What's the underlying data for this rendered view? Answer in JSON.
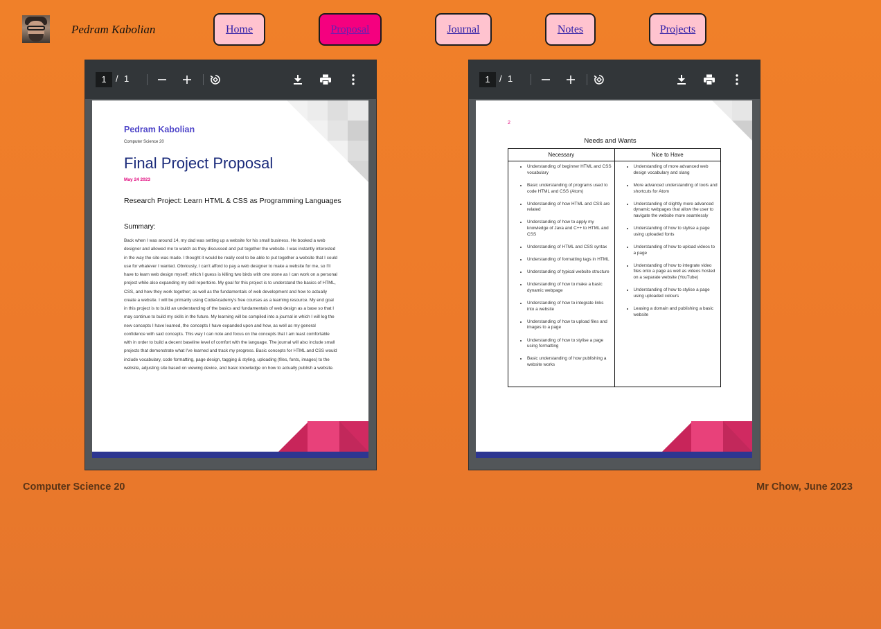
{
  "header": {
    "site_name": "Pedram Kabolian",
    "nav": [
      {
        "label": "Home "
      },
      {
        "label": "Proposal"
      },
      {
        "label": "Journal "
      },
      {
        "label": "Notes "
      },
      {
        "label": "Projects"
      }
    ],
    "active_nav": "Proposal"
  },
  "viewers": [
    {
      "page_current": "1",
      "page_sep": "/",
      "page_total": "1",
      "document": {
        "name": "Pedram Kabolian",
        "course": "Computer Science 20",
        "title": "Final Project Proposal",
        "date": "May 24 2023",
        "research": "Research Project: Learn HTML & CSS as Programming Languages",
        "summary_heading": "Summary:",
        "summary_body": "Back when I was around 14, my dad was setting up a website for his small business. He booked a web designer and allowed me to watch as they discussed and put together the website. I was instantly interested in the way the site was made. I thought it would be really cool to be able to put together a website that I could use for whatever I wanted. Obviously, I can't afford to pay a web designer to make a website for me, so I'll have to learn web design myself; which I guess is killing two birds with one stone as I can work on a personal project while also expanding my skill repertoire. My goal for this project is to understand the basics of HTML, CSS, and how they work together; as well as the fundamentals of web development and how to actually create a website. I will be primarily using CodeAcademy's free courses as a learning resource. My end goal in this project is to build an understanding of the basics and fundamentals of web design as a base so that I may continue to build my skills in the future. My learning will be compiled into a journal in which I will log the new concepts I have learned, the concepts I have expanded upon and how, as well as my general confidence with said concepts. This way I can note and focus on the concepts that I am least comfortable with in order to build a decent baseline level of comfort with the language. The journal will also include small projects that demonstrate what I've learned and track my progress. Basic concepts for HTML and CSS would include vocabulary, code formatting, page design, tagging & styling, uploading (files, fonts, images) to the website, adjusting site based on viewing device, and basic knowledge on how to actually publish a website."
      }
    },
    {
      "page_current": "1",
      "page_sep": "/",
      "page_total": "1",
      "document": {
        "page_number": "2",
        "title": "Needs and Wants",
        "col_necessary": "Necessary",
        "col_nice": "Nice to Have",
        "necessary": [
          "Understanding of beginner HTML and CSS vocabulary",
          "Basic understanding of programs used to code HTML and CSS (Atom)",
          "Understanding of how HTML and CSS are related",
          "Understanding of how to apply my knowledge of Java and C++ to HTML and CSS",
          "Understanding of HTML and CSS syntax",
          "Understanding of formatting tags in HTML",
          "Understanding of typical website structure",
          "Understanding of how to make a basic dynamic webpage",
          "Understanding of how to integrate links into a website",
          "Understanding of how to upload files and images to a page",
          "Understanding of how to stylise a page using formatting",
          "Basic understanding of how publishing a website works"
        ],
        "nice_to_have": [
          "Understanding of more advanced web design vocabulary and slang",
          "More advanced understanding of tools and shortcuts for Atom",
          "Understanding of slightly more advanced dynamic webpages that allow the user to navigate the website more seamlessly",
          "Understanding of how to stylise a page using uploaded fonts",
          "Understanding of how to upload videos to a page",
          "Understanding of how to integrate video files onto a page as well as videos hosted on a separate website (YouTube)",
          "Understanding of how to stylise a page using uploaded colours",
          "Leasing a domain and publishing a basic website"
        ]
      }
    }
  ],
  "icons": [
    "zoom-out-icon",
    "zoom-in-icon",
    "rotate-icon",
    "download-icon",
    "print-icon",
    "more-vert-icon"
  ],
  "footer": {
    "left": "Computer Science 20",
    "right": "Mr Chow, June 2023"
  },
  "colors": {
    "background": "#f08029",
    "nav_button": "#ffc3cf",
    "nav_active": "#f5007f",
    "toolbar": "#323639"
  }
}
